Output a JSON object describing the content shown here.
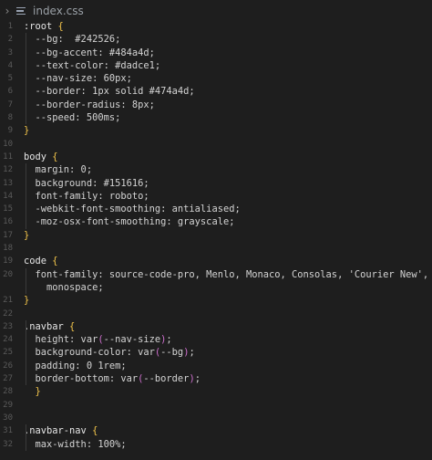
{
  "tab": {
    "filename": "index.css",
    "chevron": "›",
    "file_icon": "lines-file-icon"
  },
  "lines": [
    {
      "n": "1",
      "segs": [
        [
          ":root ",
          "sel"
        ],
        [
          "{",
          "brace"
        ]
      ]
    },
    {
      "n": "2",
      "segs": [
        [
          "  --bg:  #242526;",
          "prop"
        ]
      ]
    },
    {
      "n": "3",
      "segs": [
        [
          "  --bg-accent: #484a4d;",
          "prop"
        ]
      ]
    },
    {
      "n": "4",
      "segs": [
        [
          "  --text-color: #dadce1;",
          "prop"
        ]
      ]
    },
    {
      "n": "5",
      "segs": [
        [
          "  --nav-size: 60px;",
          "prop"
        ]
      ]
    },
    {
      "n": "6",
      "segs": [
        [
          "  --border: 1px solid #474a4d;",
          "prop"
        ]
      ]
    },
    {
      "n": "7",
      "segs": [
        [
          "  --border-radius: 8px;",
          "prop"
        ]
      ]
    },
    {
      "n": "8",
      "segs": [
        [
          "  --speed: 500ms;",
          "prop"
        ]
      ]
    },
    {
      "n": "9",
      "segs": [
        [
          "}",
          "brace"
        ]
      ]
    },
    {
      "n": "10",
      "segs": []
    },
    {
      "n": "11",
      "segs": [
        [
          "body ",
          "sel"
        ],
        [
          "{",
          "brace"
        ]
      ]
    },
    {
      "n": "12",
      "segs": [
        [
          "  margin: 0;",
          "prop"
        ]
      ]
    },
    {
      "n": "13",
      "segs": [
        [
          "  background: #151616;",
          "prop"
        ]
      ]
    },
    {
      "n": "14",
      "segs": [
        [
          "  font-family: roboto;",
          "prop"
        ]
      ]
    },
    {
      "n": "15",
      "segs": [
        [
          "  -webkit-font-smoothing: antialiased;",
          "prop"
        ]
      ]
    },
    {
      "n": "16",
      "segs": [
        [
          "  -moz-osx-font-smoothing: grayscale;",
          "prop"
        ]
      ]
    },
    {
      "n": "17",
      "segs": [
        [
          "}",
          "brace"
        ]
      ]
    },
    {
      "n": "18",
      "segs": []
    },
    {
      "n": "19",
      "segs": [
        [
          "code ",
          "sel"
        ],
        [
          "{",
          "brace"
        ]
      ]
    },
    {
      "n": "20",
      "segs": [
        [
          "  font-family: source-code-pro, Menlo, Monaco, Consolas, 'Courier New',",
          "prop"
        ]
      ]
    },
    {
      "n": "",
      "segs": [
        [
          "    monospace;",
          "prop"
        ]
      ]
    },
    {
      "n": "21",
      "segs": [
        [
          "}",
          "brace"
        ]
      ]
    },
    {
      "n": "22",
      "segs": []
    },
    {
      "n": "23",
      "segs": [
        [
          ".navbar ",
          "sel"
        ],
        [
          "{",
          "brace"
        ]
      ]
    },
    {
      "n": "24",
      "segs": [
        [
          "  height: var",
          "prop"
        ],
        [
          "(",
          "paren"
        ],
        [
          "--nav-size",
          "prop"
        ],
        [
          ")",
          "paren"
        ],
        [
          ";",
          "prop"
        ]
      ]
    },
    {
      "n": "25",
      "segs": [
        [
          "  background-color: var",
          "prop"
        ],
        [
          "(",
          "paren"
        ],
        [
          "--bg",
          "prop"
        ],
        [
          ")",
          "paren"
        ],
        [
          ";",
          "prop"
        ]
      ]
    },
    {
      "n": "26",
      "segs": [
        [
          "  padding: 0 1rem;",
          "prop"
        ]
      ]
    },
    {
      "n": "27",
      "segs": [
        [
          "  border-bottom: var",
          "prop"
        ],
        [
          "(",
          "paren"
        ],
        [
          "--border",
          "prop"
        ],
        [
          ")",
          "paren"
        ],
        [
          ";",
          "prop"
        ]
      ]
    },
    {
      "n": "28",
      "segs": [
        [
          "  }",
          "brace"
        ]
      ]
    },
    {
      "n": "29",
      "segs": []
    },
    {
      "n": "30",
      "segs": []
    },
    {
      "n": "31",
      "segs": [
        [
          ".navbar-nav ",
          "sel"
        ],
        [
          "{",
          "brace"
        ]
      ]
    },
    {
      "n": "32",
      "segs": [
        [
          "  max-width: 100%;",
          "prop"
        ]
      ]
    }
  ]
}
